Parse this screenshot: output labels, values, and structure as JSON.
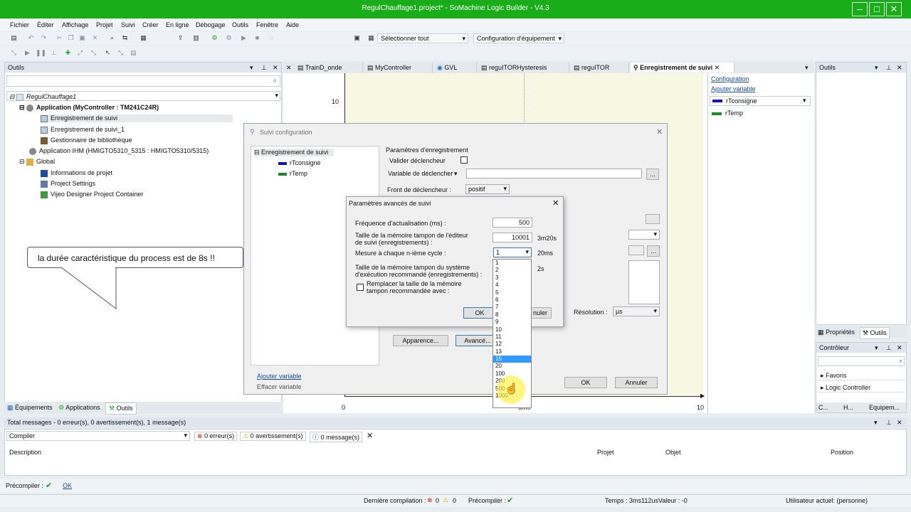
{
  "window": {
    "title": "RegulChauffage1.project* - SoMachine Logic Builder - V4.3"
  },
  "menu": [
    "Fichier",
    "Éditer",
    "Affichage",
    "Projet",
    "Suivi",
    "Créer",
    "En ligne",
    "Débogage",
    "Outils",
    "Fenêtre",
    "Aide"
  ],
  "toolbar": {
    "select_all": "Sélectionner tout",
    "config": "Configuration d'équipement"
  },
  "left_panel": {
    "title": "Outils",
    "tree": [
      "RegulChauffage1",
      "Application (MyController : TM241C24R)",
      "Enregistrement de suivi",
      "Enregistrement de suivi_1",
      "Gestionnaire de bibliothèque",
      "Application IHM (HMIGTO5310_5315 : HMIGTO5310/5315)",
      "Global",
      "Informations de projet",
      "Project Settings",
      "Vijeo Designer Project Container"
    ],
    "bottom_tabs": [
      "Équipements",
      "Applications",
      "Outils"
    ]
  },
  "tabs": [
    "TrainD_onde",
    "MyController",
    "GVL",
    "reguITORHysteresis",
    "reguITOR",
    "Enregistrement de suivi"
  ],
  "chart": {
    "y_tick": "10",
    "x_start": "0",
    "x_end": "10",
    "x_mid": "5ms"
  },
  "trace_right": {
    "link1": "Configuration",
    "link2": "Ajouter variable",
    "vars": [
      {
        "name": "rTconsigne",
        "color": "#1010c0"
      },
      {
        "name": "rTemp",
        "color": "#1a8a2a"
      }
    ]
  },
  "right_panel": {
    "title": "Outils",
    "tabs": [
      "Propriétés",
      "Outils"
    ],
    "controleur": "Contrôleur",
    "items": [
      "Favoris",
      "Logic Controller"
    ],
    "bottom": [
      "C...",
      "H...",
      "Equipem..."
    ]
  },
  "callout": {
    "text": "la durée caractéristique du process est de 8s !!"
  },
  "suivi": {
    "title": "Suivi configuration",
    "tree": [
      "Enregistrement de suivi",
      "rTconsigne",
      "rTemp"
    ],
    "group": "Paramètres d'enregistrement",
    "valider": "Valider déclencheur",
    "variable": "Variable de déclencher",
    "front": "Front de déclencheur :",
    "front_val": "positif",
    "resolution": "Résolution :",
    "resolution_val": "µs",
    "apparence": "Apparence...",
    "avance": "Avancé...",
    "add_var": "Ajouter variable",
    "clear_var": "Effacer variable",
    "ok": "OK",
    "annuler": "Annuler",
    "ellipsis": "..."
  },
  "avances": {
    "title": "Paramètres avancés de suivi",
    "freq_label": "Fréquence d'actualisation (ms) :",
    "freq_val": "500",
    "buf_label1": "Taille de la mémoire tampon de l'éditeur",
    "buf_label2": "de suivi (enregistrements) :",
    "buf_val": "10001",
    "buf_time": "3m20s",
    "cycle_label": "Mesure à chaque n-ième cycle :",
    "cycle_val": "1",
    "cycle_time": "20ms",
    "rt_label1": "Taille de la mémoire tampon du système",
    "rt_label2": "d'exécution recommandé (enregistrements) :",
    "rt_time": "2s",
    "replace1": "Remplacer la taille de la mémoire",
    "replace2": "tampon recommandée avec :",
    "ok": "OK",
    "annuler": "nuler",
    "dropdown": [
      "1",
      "2",
      "3",
      "4",
      "5",
      "6",
      "7",
      "8",
      "9",
      "10",
      "11",
      "12",
      "13",
      "15",
      "20",
      "100",
      "200",
      "500",
      "1000"
    ],
    "selected_index": 13
  },
  "messages": {
    "summary": "Total messages - 0 erreur(s), 0 avertissement(s), 1 message(s)",
    "compile": "Compiler",
    "errors": "0 erreur(s)",
    "warnings": "0 avertissement(s)",
    "msgs": "0 message(s)",
    "cols": [
      "Description",
      "Projet",
      "Objet",
      "Position"
    ]
  },
  "status": {
    "precompile": "Précompiler :",
    "ok": "OK",
    "last": "Dernière compilation :",
    "zero": "0",
    "zero2": "0",
    "precompile2": "Précompiler :",
    "time": "Temps : 3ms112usValeur : -0",
    "user": "Utilisateur actuel: (personne)"
  }
}
